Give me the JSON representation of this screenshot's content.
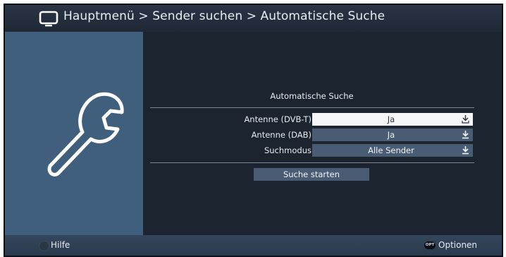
{
  "header": {
    "title": "Hauptmenü > Sender suchen > Automatische Suche",
    "icon": "tv-icon"
  },
  "left_panel": {
    "icon": "wrench-icon"
  },
  "section": {
    "title": "Automatische Suche"
  },
  "settings": [
    {
      "label": "Antenne (DVB-T)",
      "value": "Ja",
      "selected": true
    },
    {
      "label": "Antenne (DAB)",
      "value": "Ja",
      "selected": false
    },
    {
      "label": "Suchmodus",
      "value": "Alle Sender",
      "selected": false
    }
  ],
  "actions": {
    "start_label": "Suche starten"
  },
  "footer": {
    "help_label": "Hilfe",
    "options_badge": "OPT",
    "options_label": "Optionen"
  },
  "colors": {
    "panel": "#3f5f7d",
    "background": "#1c2430",
    "value_box": "#4a5c74",
    "selected_box": "#f4f5f6",
    "footer": "#2a3a4e"
  }
}
